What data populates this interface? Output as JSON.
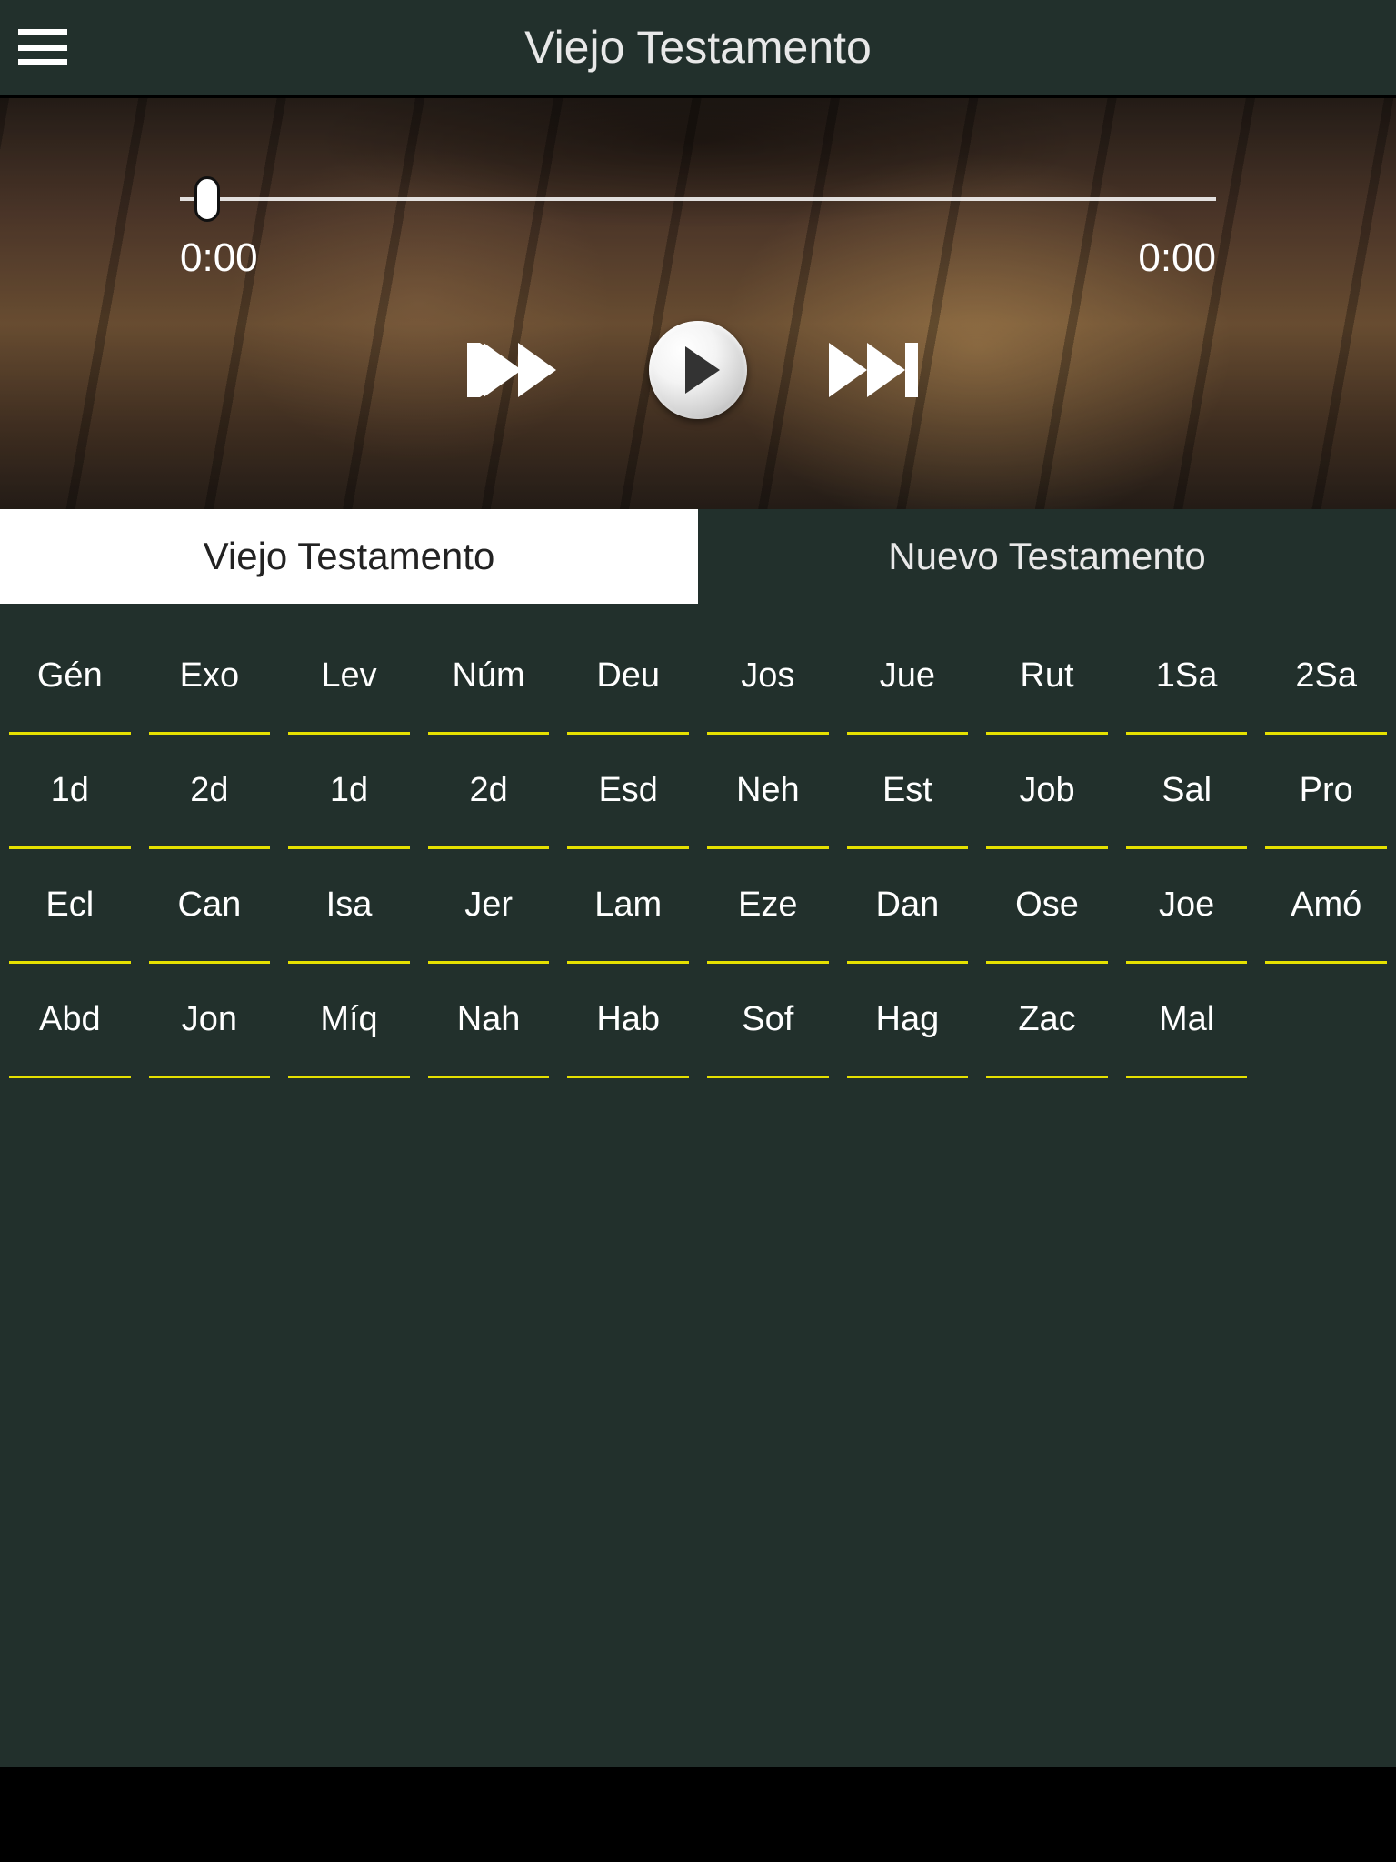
{
  "header": {
    "title": "Viejo Testamento"
  },
  "player": {
    "current_time": "0:00",
    "total_time": "0:00",
    "progress_percent": 3
  },
  "tabs": [
    {
      "label": "Viejo Testamento",
      "active": true
    },
    {
      "label": "Nuevo Testamento",
      "active": false
    }
  ],
  "books": [
    "Gén",
    "Exo",
    "Lev",
    "Núm",
    "Deu",
    "Jos",
    "Jue",
    "Rut",
    "1Sa",
    "2Sa",
    "1d",
    "2d",
    "1d",
    "2d",
    "Esd",
    "Neh",
    "Est",
    "Job",
    "Sal",
    "Pro",
    "Ecl",
    "Can",
    "Isa",
    "Jer",
    "Lam",
    "Eze",
    "Dan",
    "Ose",
    "Joe",
    "Amó",
    "Abd",
    "Jon",
    "Míq",
    "Nah",
    "Hab",
    "Sof",
    "Hag",
    "Zac",
    "Mal"
  ],
  "colors": {
    "bg_dark": "#22302c",
    "accent_underline": "#e5e000"
  }
}
